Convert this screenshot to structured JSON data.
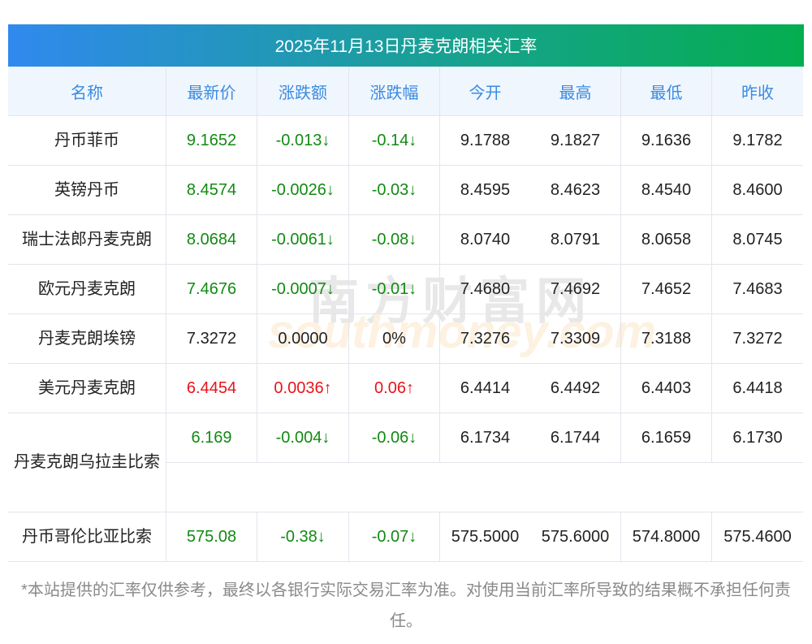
{
  "title": "2025年11月13日丹麦克朗相关汇率",
  "headers": [
    "名称",
    "最新价",
    "涨跌额",
    "涨跌幅",
    "今开",
    "最高",
    "最低",
    "昨收"
  ],
  "rows": [
    {
      "name": "丹币菲币",
      "latest": "9.1652",
      "change": "-0.013↓",
      "pct": "-0.14↓",
      "open": "9.1788",
      "high": "9.1827",
      "low": "9.1636",
      "prev": "9.1782",
      "trend": "down"
    },
    {
      "name": "英镑丹币",
      "latest": "8.4574",
      "change": "-0.0026↓",
      "pct": "-0.03↓",
      "open": "8.4595",
      "high": "8.4623",
      "low": "8.4540",
      "prev": "8.4600",
      "trend": "down"
    },
    {
      "name": "瑞士法郎丹麦克朗",
      "latest": "8.0684",
      "change": "-0.0061↓",
      "pct": "-0.08↓",
      "open": "8.0740",
      "high": "8.0791",
      "low": "8.0658",
      "prev": "8.0745",
      "trend": "down"
    },
    {
      "name": "欧元丹麦克朗",
      "latest": "7.4676",
      "change": "-0.0007↓",
      "pct": "-0.01↓",
      "open": "7.4680",
      "high": "7.4692",
      "low": "7.4652",
      "prev": "7.4683",
      "trend": "down"
    },
    {
      "name": "丹麦克朗埃镑",
      "latest": "7.3272",
      "change": "0.0000",
      "pct": "0%",
      "open": "7.3276",
      "high": "7.3309",
      "low": "7.3188",
      "prev": "7.3272",
      "trend": "flat"
    },
    {
      "name": "美元丹麦克朗",
      "latest": "6.4454",
      "change": "0.0036↑",
      "pct": "0.06↑",
      "open": "6.4414",
      "high": "6.4492",
      "low": "6.4403",
      "prev": "6.4418",
      "trend": "up"
    },
    {
      "name": "丹麦克朗乌拉圭比索",
      "latest": "6.169",
      "change": "-0.004↓",
      "pct": "-0.06↓",
      "open": "6.1734",
      "high": "6.1744",
      "low": "6.1659",
      "prev": "6.1730",
      "trend": "down",
      "wrap": true
    },
    {
      "name": "丹币哥伦比亚比索",
      "latest": "575.08",
      "change": "-0.38↓",
      "pct": "-0.07↓",
      "open": "575.5000",
      "high": "575.6000",
      "low": "574.8000",
      "prev": "575.4600",
      "trend": "down"
    }
  ],
  "footer": "*本站提供的汇率仅供参考，最终以各银行实际交易汇率为准。对使用当前汇率所导致的结果概不承担任何责任。",
  "watermark": {
    "cn": "南方财富网",
    "en": "southmoney.com"
  },
  "colors": {
    "up": "#e8141a",
    "down": "#128a12",
    "header_text": "#3a8be0"
  }
}
